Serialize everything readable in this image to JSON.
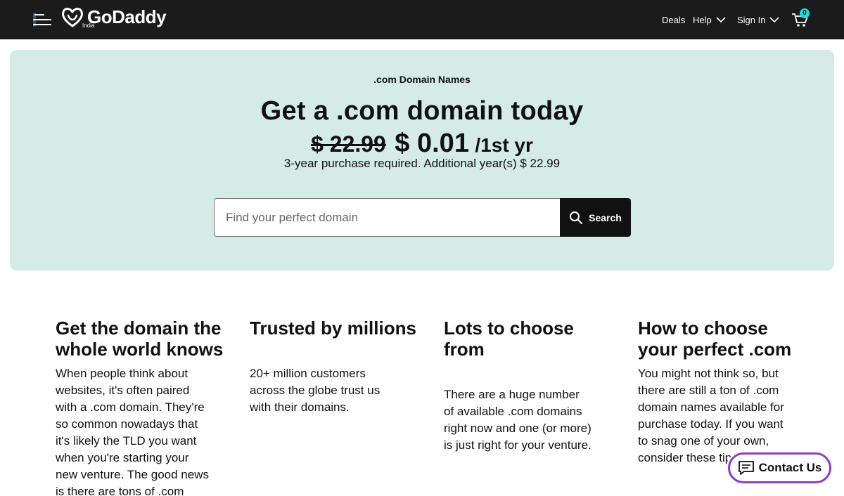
{
  "header": {
    "logo_text": "GoDaddy",
    "logo_region": "India",
    "nav": {
      "deals": "Deals",
      "help": "Help",
      "sign_in": "Sign In"
    },
    "cart_count": "0",
    "cart_badge_color": "#1bdbdb"
  },
  "hero": {
    "eyebrow": ".com Domain Names",
    "title": "Get a .com domain today",
    "price_old": "$ 22.99",
    "price_new": "$ 0.01",
    "price_term": "/1st yr",
    "price_note": "3-year purchase required. Additional year(s) $ 22.99",
    "background_color": "#d4ebe6"
  },
  "search": {
    "placeholder": "Find your perfect domain",
    "button_label": "Search"
  },
  "features": [
    {
      "title": "Get the domain the whole world knows",
      "body": "When people think about websites, it's often paired with a .com domain. They're so common nowadays that it's likely the TLD you want when you're starting your new venture. The good news is there are tons of .com"
    },
    {
      "title": "Trusted by millions",
      "body": "20+ million customers across the globe trust us with their domains."
    },
    {
      "title": "Lots to choose from",
      "body": "There are a huge number of available .com domains right now and one (or more) is just right for your venture."
    },
    {
      "title": "How to choose your perfect .com",
      "body": "You might not think so, but there are still a ton of .com domain names available for purchase today. If you want to snag one of your own, consider these tips:"
    }
  ],
  "contact": {
    "label": "Contact Us",
    "border_color": "#8d3ec4"
  },
  "icons": [
    "menu-icon",
    "godaddy-logo-icon",
    "chevron-down-icon",
    "cart-icon",
    "search-icon",
    "chat-icon"
  ]
}
